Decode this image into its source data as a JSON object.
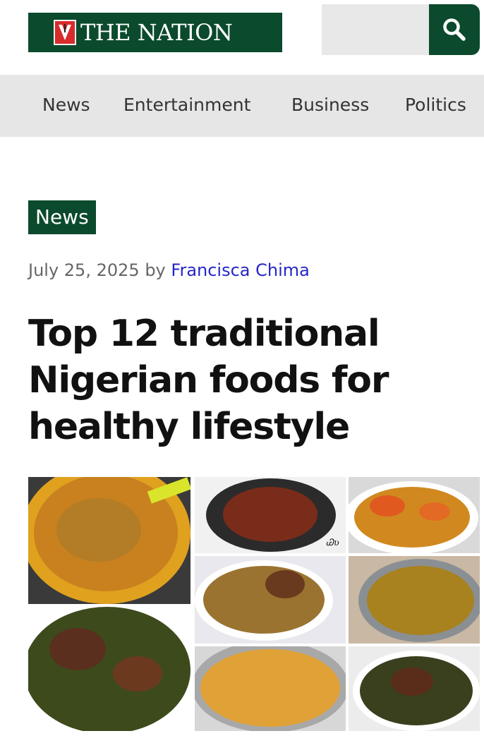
{
  "header": {
    "logo_text": "THE NATION",
    "search_placeholder": "",
    "search_icon": "search-icon"
  },
  "nav": {
    "items": [
      "News",
      "Entertainment",
      "Business",
      "Politics"
    ]
  },
  "article": {
    "category": "News",
    "date": "July 25, 2025",
    "by": "by",
    "author": "Francisca Chima",
    "title": "Top 12 traditional Nigerian foods for healthy lifestyle",
    "image_watermark": "Ꮚʋ"
  },
  "colors": {
    "brand_green": "#0b4a2c",
    "nav_bg": "#e6e6e6",
    "author_link": "#2626c9",
    "logo_red": "#d92b2b"
  }
}
